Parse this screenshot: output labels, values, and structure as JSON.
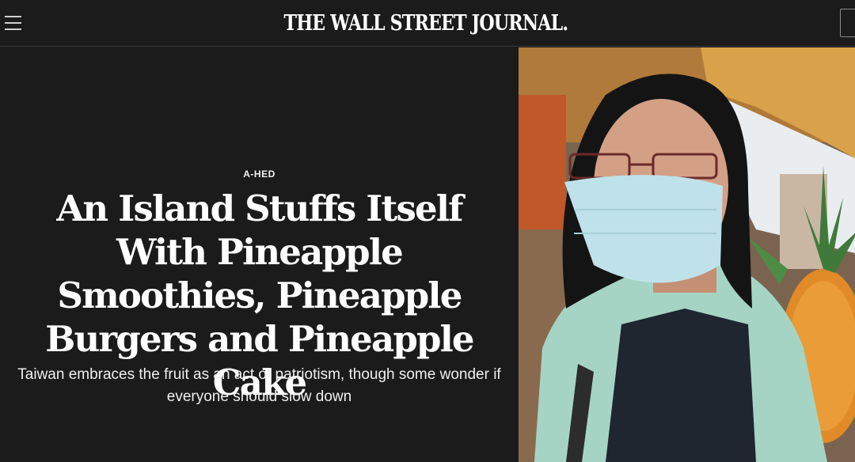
{
  "header": {
    "masthead": "THE WALL STREET JOURNAL.",
    "menu_icon": "hamburger-menu-icon"
  },
  "article": {
    "kicker": "A-HED",
    "headline": "An Island Stuffs Itself With Pineapple Smoothies, Pineapple Burgers and Pineapple Cake",
    "dek": "Taiwan embraces the fruit as an act of patriotism, though some wonder if everyone should slow down"
  },
  "colors": {
    "background": "#1b1b1b",
    "text": "#ffffff",
    "divider": "#3a3a3a"
  }
}
